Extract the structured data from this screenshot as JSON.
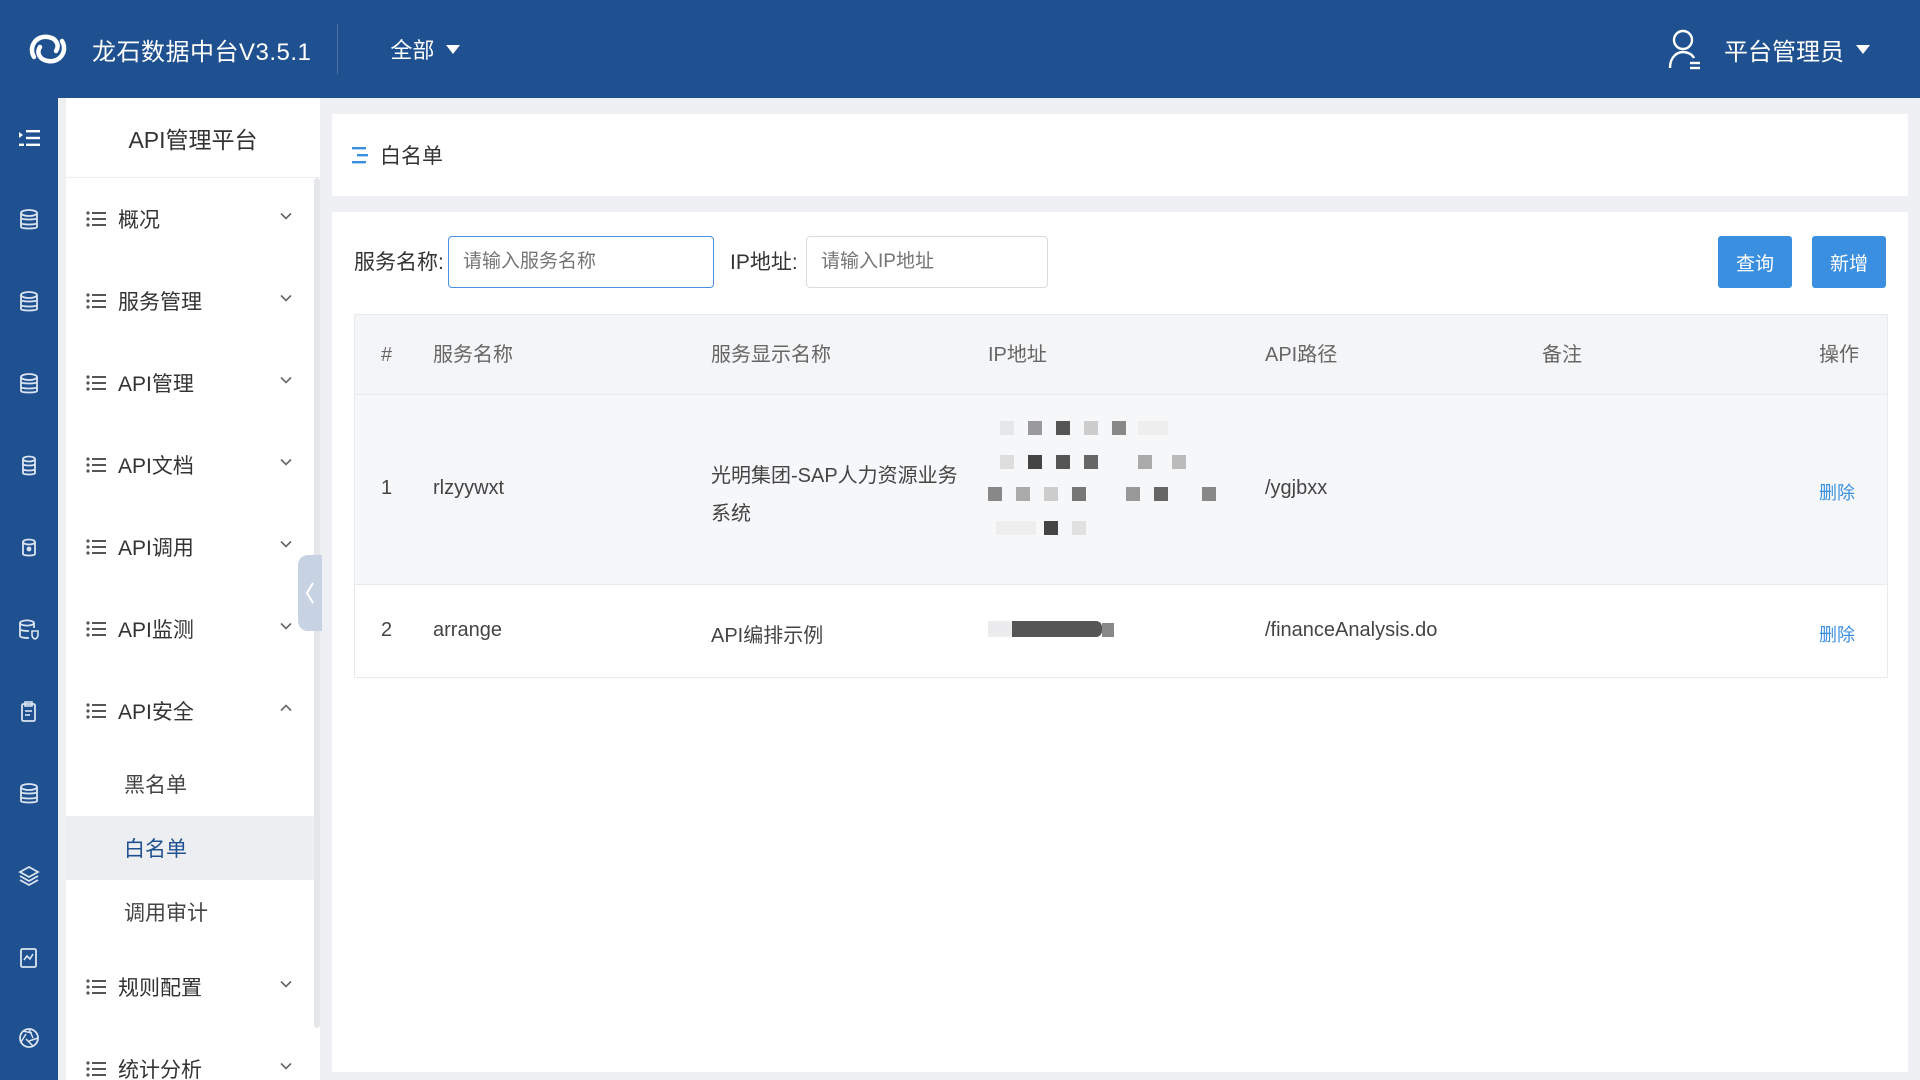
{
  "header": {
    "app_title": "龙石数据中台V3.5.1",
    "scope_label": "全部",
    "user_name": "平台管理员"
  },
  "icons": {
    "logo": "logo-icon",
    "rail": [
      "menu-toggle-icon",
      "database-icon",
      "database-icon",
      "database-icon",
      "database-icon",
      "shield-database-icon",
      "database-settings-icon",
      "clipboard-icon",
      "database-icon",
      "layers-icon",
      "report-icon",
      "aperture-icon"
    ]
  },
  "sidenav": {
    "title": "API管理平台",
    "groups": [
      {
        "label": "概况"
      },
      {
        "label": "服务管理"
      },
      {
        "label": "API管理"
      },
      {
        "label": "API文档"
      },
      {
        "label": "API调用"
      },
      {
        "label": "API监测"
      },
      {
        "label": "API安全"
      },
      {
        "label": "规则配置"
      },
      {
        "label": "统计分析"
      }
    ],
    "security_items": [
      "黑名单",
      "白名单",
      "调用审计"
    ]
  },
  "breadcrumb": {
    "title": "白名单"
  },
  "filters": {
    "service_label": "服务名称:",
    "service_placeholder": "请输入服务名称",
    "ip_label": "IP地址:",
    "ip_placeholder": "请输入IP地址",
    "query_button": "查询",
    "add_button": "新增"
  },
  "table": {
    "columns": [
      "#",
      "服务名称",
      "服务显示名称",
      "IP地址",
      "API路径",
      "备注",
      "操作"
    ],
    "rows": [
      {
        "index": "1",
        "service": "rlzyywxt",
        "display_line1": "光明集团-SAP人力资源业务",
        "display_line2": "系统",
        "api_path": "/ygjbxx",
        "remark": "",
        "action": "删除"
      },
      {
        "index": "2",
        "service": "arrange",
        "display_line1": "API编排示例",
        "display_line2": "",
        "api_path": "/financeAnalysis.do",
        "remark": "",
        "action": "删除"
      }
    ]
  },
  "colors": {
    "brand": "#1f5190",
    "accent": "#3b8fe0"
  }
}
